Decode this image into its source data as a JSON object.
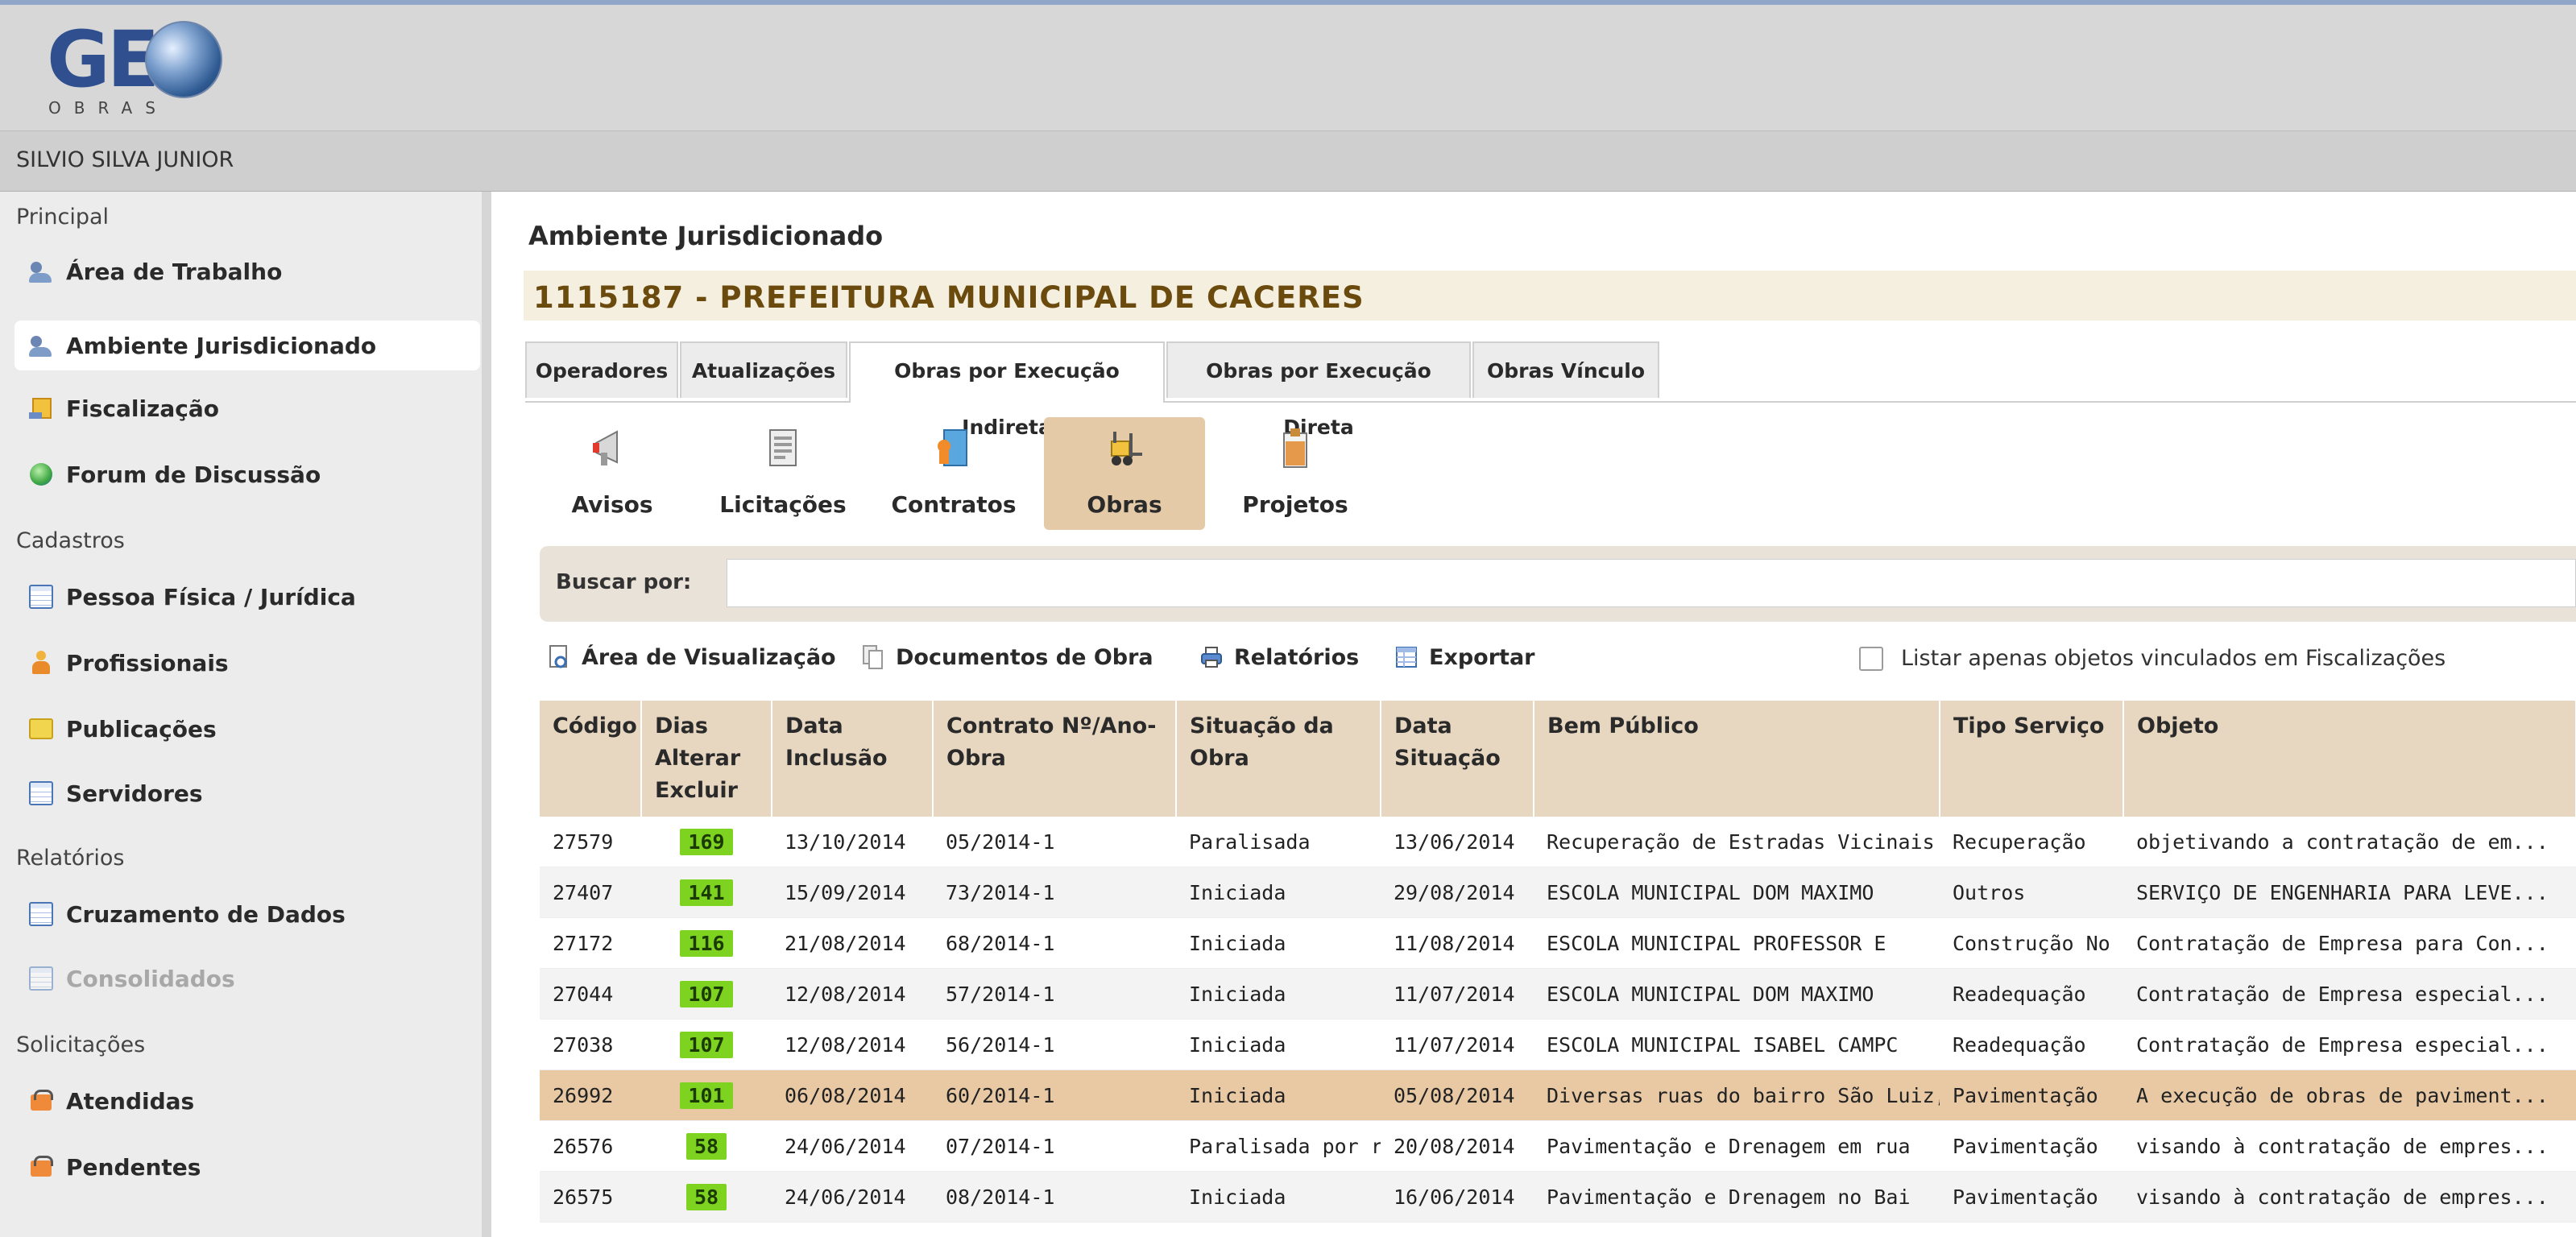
{
  "header": {
    "logo_text": "GE",
    "logo_sub": "OBRAS",
    "user_name": "SILVIO SILVA JUNIOR"
  },
  "sidebar": {
    "sections": [
      {
        "title": "Principal",
        "items": [
          {
            "label": "Área de Trabalho",
            "icon": "people-icon"
          },
          {
            "label": "Ambiente Jurisdicionado",
            "icon": "people-icon",
            "active": true
          },
          {
            "label": "Fiscalização",
            "icon": "inspection-icon"
          },
          {
            "label": "Forum de Discussão",
            "icon": "globe-icon"
          }
        ]
      },
      {
        "title": "Cadastros",
        "items": [
          {
            "label": "Pessoa Física / Jurídica",
            "icon": "grid-icon"
          },
          {
            "label": "Profissionais",
            "icon": "person-icon"
          },
          {
            "label": "Publicações",
            "icon": "folder-icon"
          },
          {
            "label": "Servidores",
            "icon": "grid-icon"
          }
        ]
      },
      {
        "title": "Relatórios",
        "items": [
          {
            "label": "Cruzamento de Dados",
            "icon": "grid-icon"
          },
          {
            "label": "Consolidados",
            "icon": "grid-icon",
            "disabled": true
          }
        ]
      },
      {
        "title": "Solicitações",
        "items": [
          {
            "label": "Atendidas",
            "icon": "box-icon"
          },
          {
            "label": "Pendentes",
            "icon": "box-icon"
          }
        ]
      }
    ]
  },
  "main": {
    "title": "Ambiente Jurisdicionado",
    "entity": "1115187 - PREFEITURA MUNICIPAL DE CACERES",
    "tabs": [
      "Operadores",
      "Atualizações",
      "Obras por Execução Indireta",
      "Obras por Execução Direta",
      "Obras Vínculo"
    ],
    "active_tab": "Obras por Execução Indireta",
    "toolbar": [
      {
        "label": "Avisos",
        "icon": "megaphone-icon"
      },
      {
        "label": "Licitações",
        "icon": "document-icon"
      },
      {
        "label": "Contratos",
        "icon": "contract-icon"
      },
      {
        "label": "Obras",
        "icon": "forklift-icon",
        "active": true
      },
      {
        "label": "Projetos",
        "icon": "clipboard-icon"
      }
    ],
    "search": {
      "label": "Buscar por:",
      "value": ""
    },
    "actions": {
      "view": "Área de Visualização",
      "docs": "Documentos de Obra",
      "reports": "Relatórios",
      "export": "Exportar",
      "filter_label": "Listar apenas objetos vinculados em Fiscalizações"
    },
    "table": {
      "headers": [
        "Código",
        "Dias Alterar Excluir",
        "Data Inclusão",
        "Contrato Nº/Ano-Obra",
        "Situação da Obra",
        "Data Situação",
        "Bem Público",
        "Tipo Serviço",
        "Objeto"
      ],
      "rows": [
        [
          "27579",
          "169",
          "13/10/2014",
          "05/2014-1",
          "Paralisada",
          "13/06/2014",
          "Recuperação de Estradas Vicinais -",
          "Recuperação",
          "objetivando a contratação de em..."
        ],
        [
          "27407",
          "141",
          "15/09/2014",
          "73/2014-1",
          "Iniciada",
          "29/08/2014",
          "ESCOLA MUNICIPAL DOM MAXIMO",
          "Outros",
          "SERVIÇO DE ENGENHARIA PARA LEVE..."
        ],
        [
          "27172",
          "116",
          "21/08/2014",
          "68/2014-1",
          "Iniciada",
          "11/08/2014",
          "ESCOLA MUNICIPAL PROFESSOR E",
          "Construção No",
          "Contratação de Empresa para Con..."
        ],
        [
          "27044",
          "107",
          "12/08/2014",
          "57/2014-1",
          "Iniciada",
          "11/07/2014",
          "ESCOLA MUNICIPAL DOM MAXIMO",
          "Readequação",
          "Contratação de Empresa especial..."
        ],
        [
          "27038",
          "107",
          "12/08/2014",
          "56/2014-1",
          "Iniciada",
          "11/07/2014",
          "ESCOLA MUNICIPAL ISABEL CAMPC",
          "Readequação",
          "Contratação de Empresa especial..."
        ],
        [
          "26992",
          "101",
          "06/08/2014",
          "60/2014-1",
          "Iniciada",
          "05/08/2014",
          "Diversas ruas do bairro São Luiz, [",
          "Pavimentação",
          "A execução de obras de paviment..."
        ],
        [
          "26576",
          "58",
          "24/06/2014",
          "07/2014-1",
          "Paralisada por re",
          "20/08/2014",
          "Pavimentação e Drenagem em rua",
          "Pavimentação",
          "visando à contratação de empres..."
        ],
        [
          "26575",
          "58",
          "24/06/2014",
          "08/2014-1",
          "Iniciada",
          "16/06/2014",
          "Pavimentação e Drenagem no Bai",
          "Pavimentação",
          "visando à contratação de empres..."
        ]
      ],
      "highlighted_row": 5
    }
  },
  "colors": {
    "days_badge": "#7ed321",
    "highlight_row": "#e8c9a4",
    "header_bg": "#e7d7c0",
    "entity_text": "#6b4a0e"
  }
}
